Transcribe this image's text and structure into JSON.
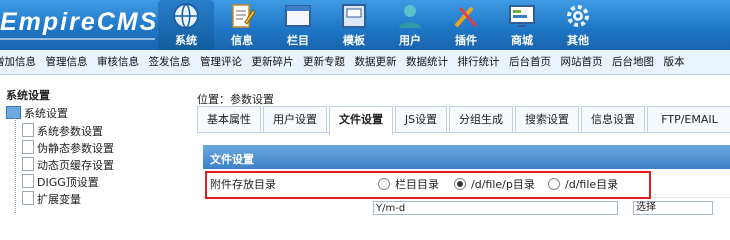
{
  "header": {
    "logo": "EmpireCMS",
    "nav": [
      {
        "label": "系统",
        "icon": "globe-icon",
        "active": true
      },
      {
        "label": "信息",
        "icon": "document-edit-icon"
      },
      {
        "label": "栏目",
        "icon": "window-icon"
      },
      {
        "label": "模板",
        "icon": "template-icon"
      },
      {
        "label": "用户",
        "icon": "user-icon"
      },
      {
        "label": "插件",
        "icon": "tools-icon"
      },
      {
        "label": "商城",
        "icon": "monitor-icon"
      },
      {
        "label": "其他",
        "icon": "gear-icon"
      }
    ]
  },
  "submenu": [
    "增加信息",
    "管理信息",
    "审核信息",
    "签发信息",
    "管理评论",
    "更新碎片",
    "更新专题",
    "数据更新",
    "数据统计",
    "排行统计",
    "后台首页",
    "网站首页",
    "后台地图",
    "版本"
  ],
  "sidebar": {
    "title": "系统设置",
    "root": "系统设置",
    "items": [
      "系统参数设置",
      "伪静态参数设置",
      "动态页缓存设置",
      "DIGG顶设置",
      "扩展变量"
    ]
  },
  "main": {
    "position": "位置：参数设置",
    "tabs": [
      "基本属性",
      "用户设置",
      "文件设置",
      "JS设置",
      "分组生成",
      "搜索设置",
      "信息设置",
      "FTP/EMAIL"
    ],
    "active_tab": "文件设置",
    "panel_title": "文件设置",
    "row_label": "附件存放目录",
    "options": [
      {
        "label": "栏目目录",
        "checked": false
      },
      {
        "label": "/d/file/p目录",
        "checked": true
      },
      {
        "label": "/d/file目录",
        "checked": false
      }
    ],
    "next_row": {
      "input_value": "Y/m-d",
      "select_value": "选择"
    }
  },
  "colors": {
    "header": "#1f78c8",
    "highlight_border": "#e21c1c"
  }
}
